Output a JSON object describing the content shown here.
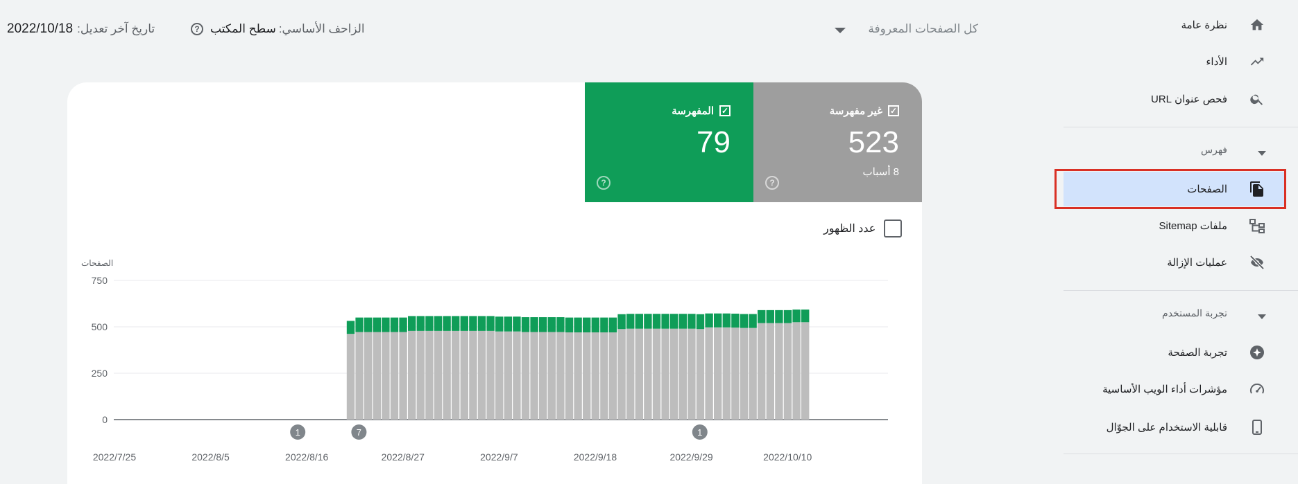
{
  "sidebar": {
    "items": [
      {
        "label": "نظرة عامة",
        "icon": "home-icon"
      },
      {
        "label": "الأداء",
        "icon": "trending-up-icon"
      },
      {
        "label": "فحص عنوان URL",
        "icon": "search-icon"
      }
    ],
    "index_section": {
      "title": "فهرس",
      "items": [
        {
          "label": "الصفحات",
          "icon": "pages-icon",
          "selected": true
        },
        {
          "label": "ملفات Sitemap",
          "icon": "sitemap-icon"
        },
        {
          "label": "عمليات الإزالة",
          "icon": "visibility-off-icon"
        }
      ]
    },
    "experience_section": {
      "title": "تجربة المستخدم",
      "items": [
        {
          "label": "تجربة الصفحة",
          "icon": "page-experience-icon"
        },
        {
          "label": "مؤشرات أداء الويب الأساسية",
          "icon": "speed-icon"
        },
        {
          "label": "قابلية الاستخدام على الجوّال",
          "icon": "mobile-icon"
        }
      ]
    }
  },
  "header": {
    "filter_label": "كل الصفحات المعروفة",
    "crawler_label": "الزاحف الأساسي:",
    "crawler_value": "سطح المكتب",
    "updated_label": "تاريخ آخر تعديل:",
    "updated_value": "2022/10/18"
  },
  "tiles": {
    "not_indexed": {
      "title": "غير مفهرسة",
      "count": "523",
      "sub": "8 أسباب",
      "color": "#9e9e9e"
    },
    "indexed": {
      "title": "المفهرسة",
      "count": "79",
      "color": "#0f9d58"
    }
  },
  "impressions_label": "عدد الظهور",
  "chart_data": {
    "type": "bar",
    "stacked": true,
    "ylabel": "الصفحات",
    "y_ticks": [
      "750",
      "500",
      "250",
      "0"
    ],
    "ylim": [
      0,
      750
    ],
    "x_tick_labels": [
      "2022/7/25",
      "2022/8/5",
      "2022/8/16",
      "2022/8/27",
      "2022/9/7",
      "2022/9/18",
      "2022/9/29",
      "2022/10/10"
    ],
    "first_date": "2022/7/25",
    "first_bar_date": "2022/8/22",
    "series": [
      {
        "name": "غير مفهرسة",
        "color": "#bdbdbd",
        "values": [
          462,
          472,
          472,
          472,
          472,
          472,
          472,
          478,
          478,
          478,
          478,
          478,
          478,
          478,
          478,
          478,
          478,
          475,
          475,
          475,
          472,
          472,
          472,
          472,
          472,
          470,
          470,
          470,
          470,
          470,
          470,
          488,
          490,
          490,
          490,
          490,
          490,
          490,
          490,
          490,
          488,
          497,
          497,
          497,
          496,
          494,
          494,
          520,
          520,
          520,
          520,
          525,
          525
        ]
      },
      {
        "name": "المفهرسة",
        "color": "#0f9d58",
        "values": [
          70,
          78,
          78,
          78,
          78,
          78,
          78,
          80,
          80,
          80,
          80,
          80,
          80,
          80,
          80,
          80,
          80,
          80,
          80,
          80,
          80,
          80,
          80,
          80,
          80,
          80,
          80,
          80,
          80,
          80,
          80,
          80,
          80,
          80,
          80,
          80,
          80,
          80,
          80,
          80,
          80,
          75,
          75,
          75,
          75,
          75,
          75,
          70,
          70,
          70,
          70,
          68,
          68
        ]
      }
    ],
    "annotations": [
      {
        "date": "2022/8/16",
        "label": "1"
      },
      {
        "date": "2022/8/23",
        "label": "7"
      },
      {
        "date": "2022/10/1",
        "label": "1"
      }
    ],
    "grid": true
  }
}
